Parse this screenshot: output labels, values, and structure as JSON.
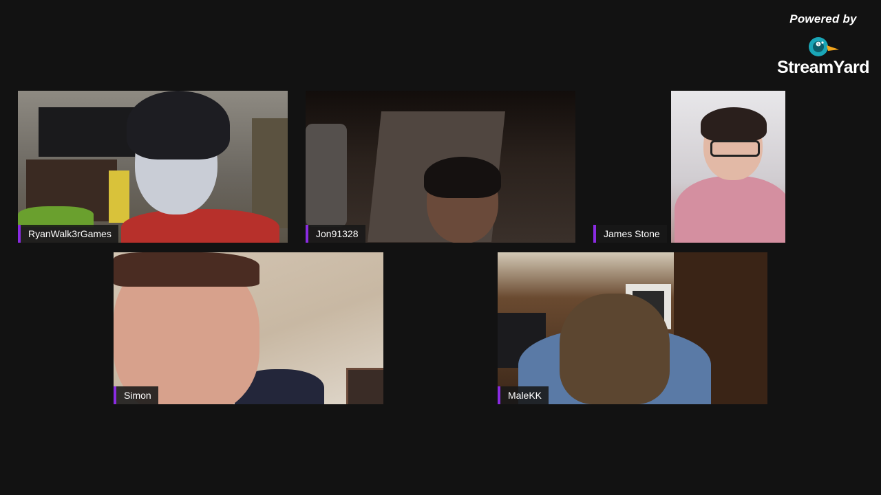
{
  "branding": {
    "powered_by": "Powered by",
    "product": "StreamYard",
    "logo_icon": "streamyard-duck-icon",
    "accent_color": "#8a2be2"
  },
  "participants": [
    {
      "name": "RyanWalk3rGames"
    },
    {
      "name": "Jon91328"
    },
    {
      "name": "James Stone"
    },
    {
      "name": "Simon"
    },
    {
      "name": "MaleKK"
    }
  ]
}
